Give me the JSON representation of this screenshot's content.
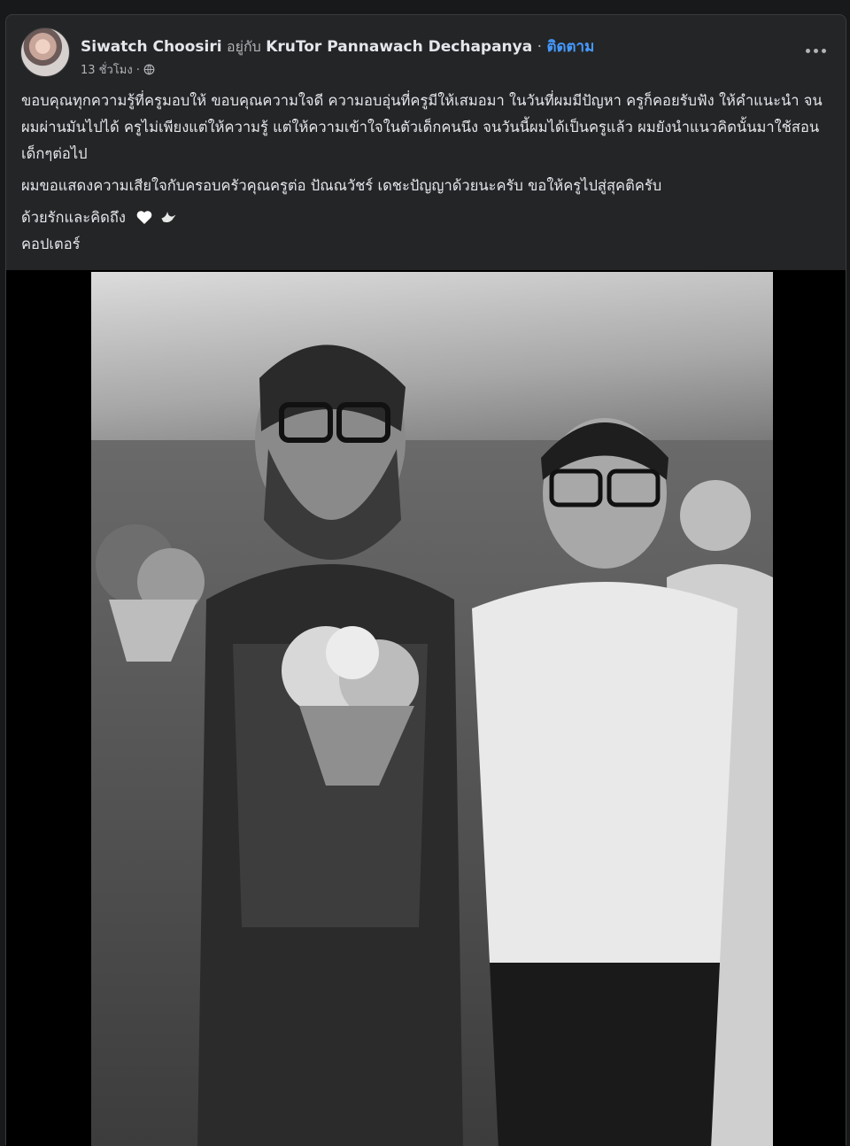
{
  "post": {
    "author": "Siwatch Choosiri",
    "with_text": "อยู่กับ",
    "tagged": "KruTor Pannawach Dechapanya",
    "separator": "·",
    "follow_label": "ติดตาม",
    "time": "13 ชั่วโมง ·",
    "privacy_icon": "globe-icon",
    "paragraphs": [
      "ขอบคุณทุกความรู้ที่ครูมอบให้ ขอบคุณความใจดี ความอบอุ่นที่ครูมีให้เสมอมา ในวันที่ผมมีปัญหา ครูก็คอยรับฟัง ให้คำแนะนำ จนผมผ่านมันไปได้ ครูไม่เพียงแต่ให้ความรู้ แต่ให้ความเข้าใจในตัวเด็กคนนึง จนวันนี้ผมได้เป็นครูแล้ว ผมยังนำแนวคิดนั้นมาใช้สอนเด็กๆต่อไป",
      "ผมขอแสดงความเสียใจกับครอบครัวคุณครูต่อ ปัณณวัชร์ เดชะปัญญาด้วยนะครับ ขอให้ครูไปสู่สุคติครับ"
    ],
    "closing_line": "ด้วยรักและคิดถึง",
    "signature": "คอปเตอร์",
    "emojis": [
      "heart-icon",
      "dove-icon"
    ]
  },
  "colors": {
    "background": "#18191a",
    "card": "#242526",
    "text": "#e4e6eb",
    "secondary_text": "#b0b3b8",
    "link": "#4599ff"
  }
}
